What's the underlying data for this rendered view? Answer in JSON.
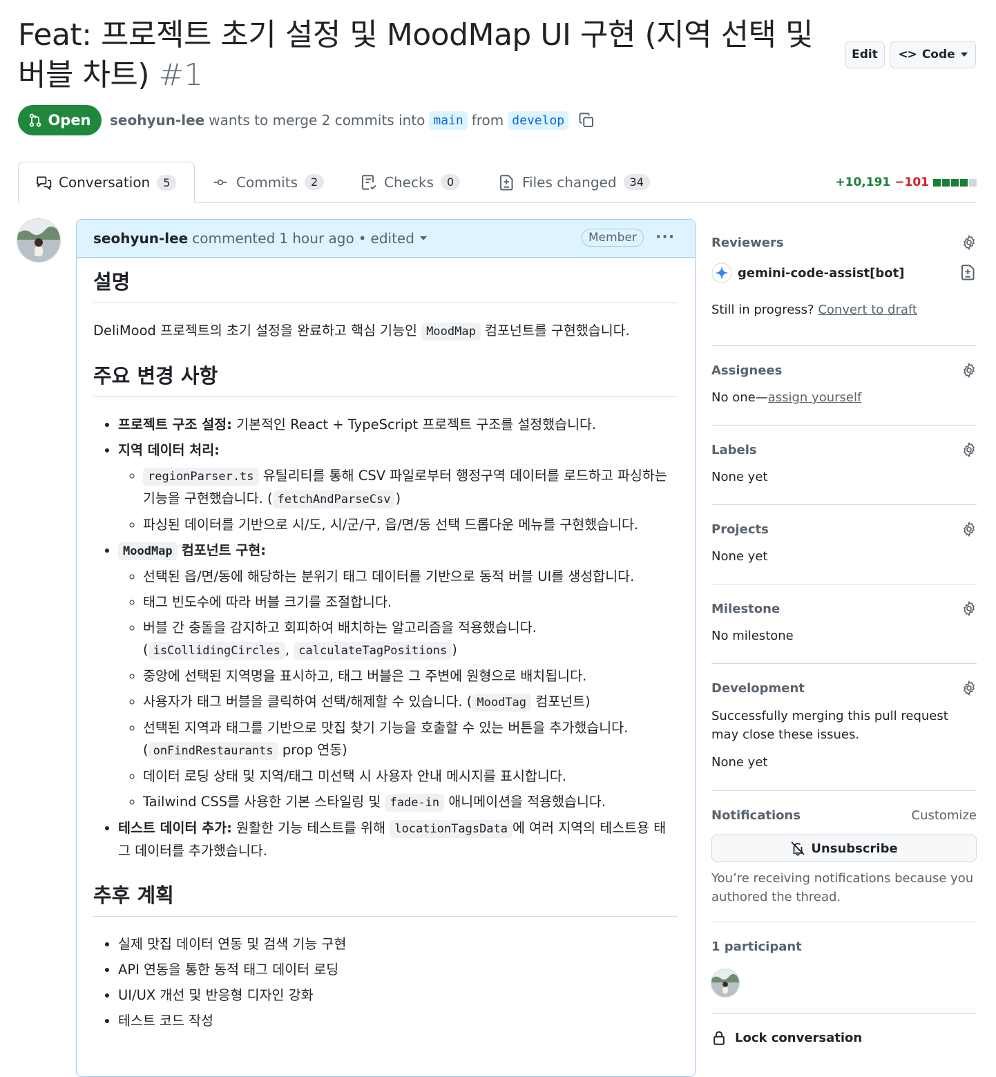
{
  "pr": {
    "title": "Feat: 프로젝트 초기 설정 및 MoodMap UI 구현 (지역 선택 및 버블 차트)",
    "number": "#1",
    "state": "Open",
    "author": "seohyun-lee",
    "merge_text": "wants to merge 2 commits into",
    "base_branch": "main",
    "from_text": "from",
    "head_branch": "develop"
  },
  "header_buttons": {
    "edit": "Edit",
    "code": "Code"
  },
  "tabs": [
    {
      "label": "Conversation",
      "count": "5"
    },
    {
      "label": "Commits",
      "count": "2"
    },
    {
      "label": "Checks",
      "count": "0"
    },
    {
      "label": "Files changed",
      "count": "34"
    }
  ],
  "diffstat": {
    "additions": "+10,191",
    "deletions": "−101",
    "colors": [
      "#1a7f37",
      "#1a7f37",
      "#1a7f37",
      "#1a7f37",
      "#d1d9e0"
    ]
  },
  "comment": {
    "author": "seohyun-lee",
    "action": "commented",
    "time": "1 hour ago",
    "separator": "•",
    "edited": "edited",
    "role": "Member",
    "more": "···",
    "h_desc": "설명",
    "desc_pre": "DeliMood 프로젝트의 초기 설정을 완료하고 핵심 기능인",
    "desc_code": "MoodMap",
    "desc_post": "컴포넌트를 구현했습니다.",
    "h_changes": "주요 변경 사항",
    "i1_label": "프로젝트 구조 설정:",
    "i1_text": "기본적인 React + TypeScript 프로젝트 구조를 설정했습니다.",
    "i2_label": "지역 데이터 처리:",
    "i2a_code": "regionParser.ts",
    "i2a_text": "유틸리티를 통해 CSV 파일로부터 행정구역 데이터를 로드하고 파싱하는 기능을 구현했습니다. (",
    "i2a_code2": "fetchAndParseCsv",
    "close_paren": ")",
    "i2b": "파싱된 데이터를 기반으로 시/도, 시/군/구, 읍/면/동 선택 드롭다운 메뉴를 구현했습니다.",
    "i3_code": "MoodMap",
    "i3_label": "컴포넌트 구현:",
    "i3a": "선택된 읍/면/동에 해당하는 분위기 태그 데이터를 기반으로 동적 버블 UI를 생성합니다.",
    "i3b": "태그 빈도수에 따라 버블 크기를 조절합니다.",
    "i3c": "버블 간 충돌을 감지하고 회피하여 배치하는 알고리즘을 적용했습니다.",
    "open_paren": "(",
    "i3c_code1": "isCollidingCircles",
    "comma": ",",
    "i3c_code2": "calculateTagPositions",
    "i3d": "중앙에 선택된 지역명을 표시하고, 태그 버블은 그 주변에 원형으로 배치됩니다.",
    "i3e": "사용자가 태그 버블을 클릭하여 선택/해제할 수 있습니다. (",
    "i3e_code": "MoodTag",
    "i3e_post": "컴포넌트)",
    "i3f": "선택된 지역과 태그를 기반으로 맛집 찾기 기능을 호출할 수 있는 버튼을 추가했습니다.",
    "i3f_code": "onFindRestaurants",
    "i3f_post": "prop 연동)",
    "i3g": "데이터 로딩 상태 및 지역/태그 미선택 시 사용자 안내 메시지를 표시합니다.",
    "i3h_pre": "Tailwind CSS를 사용한 기본 스타일링 및",
    "i3h_code": "fade-in",
    "i3h_post": "애니메이션을 적용했습니다.",
    "i4_label": "테스트 데이터 추가:",
    "i4_pre": "원활한 기능 테스트를 위해",
    "i4_code": "locationTagsData",
    "i4_post": "에 여러 지역의 테스트용 태그 데이터를 추가했습니다.",
    "h_plan": "추후 계획",
    "plan": [
      "실제 맛집 데이터 연동 및 검색 기능 구현",
      "API 연동을 통한 동적 태그 데이터 로딩",
      "UI/UX 개선 및 반응형 디자인 강화",
      "테스트 코드 작성"
    ]
  },
  "sidebar": {
    "reviewers": "Reviewers",
    "reviewer_name": "gemini-code-assist[bot]",
    "draft_q": "Still in progress?",
    "draft_link": "Convert to draft",
    "assignees": "Assignees",
    "assignees_none": "No one—",
    "assign_link": "assign yourself",
    "labels": "Labels",
    "labels_none": "None yet",
    "projects": "Projects",
    "projects_none": "None yet",
    "milestone": "Milestone",
    "milestone_none": "No milestone",
    "development": "Development",
    "dev_text": "Successfully merging this pull request may close these issues.",
    "dev_none": "None yet",
    "notifications": "Notifications",
    "customize": "Customize",
    "unsubscribe": "Unsubscribe",
    "notif_reason": "You’re receiving notifications because you authored the thread.",
    "participants": "1 participant",
    "lock": "Lock conversation"
  }
}
